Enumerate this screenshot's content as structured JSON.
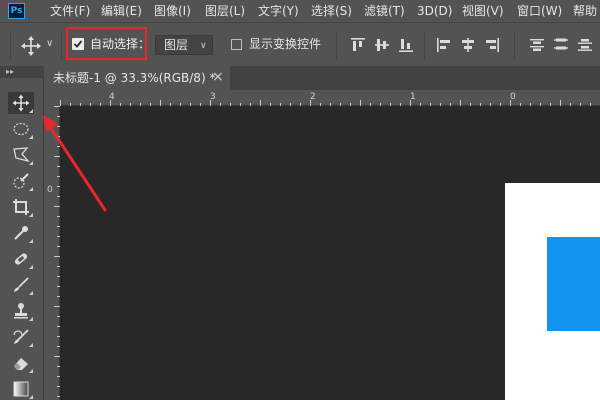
{
  "app": {
    "logo_text": "Ps"
  },
  "menu": {
    "items": [
      "文件(F)",
      "编辑(E)",
      "图像(I)",
      "图层(L)",
      "文字(Y)",
      "选择(S)",
      "滤镜(T)",
      "3D(D)",
      "视图(V)",
      "窗口(W)",
      "帮助"
    ]
  },
  "options_bar": {
    "tool_icon": "move-icon",
    "auto_select_label": "自动选择：",
    "auto_select_checked": true,
    "target_dropdown_value": "图层",
    "show_transform_label": "显示变换控件",
    "show_transform_checked": false,
    "align_icons": [
      "align-top-edges-icon",
      "align-vertical-centers-icon",
      "align-bottom-edges-icon",
      "align-left-edges-icon",
      "align-horizontal-centers-icon",
      "align-right-edges-icon",
      "distribute-top-icon",
      "distribute-vertical-centers-icon",
      "distribute-bottom-icon"
    ]
  },
  "document_tab": {
    "label": "未标题-1 @ 33.3%(RGB/8) *",
    "close": "×"
  },
  "rulers": {
    "top_labels": [
      "4",
      "3",
      "2",
      "1",
      "0"
    ],
    "left_labels": [
      "0"
    ]
  },
  "tools": [
    "move-icon",
    "elliptical-marquee-icon",
    "lasso-icon",
    "quick-selection-icon",
    "crop-icon",
    "eyedropper-icon",
    "healing-brush-icon",
    "brush-icon",
    "clone-stamp-icon",
    "history-brush-icon",
    "eraser-icon",
    "gradient-icon"
  ],
  "colors": {
    "ui_bg": "#535353",
    "canvas_bg": "#282828",
    "highlight_red": "#e8262b",
    "document_white": "#ffffff",
    "shape_blue": "#1394f0"
  }
}
